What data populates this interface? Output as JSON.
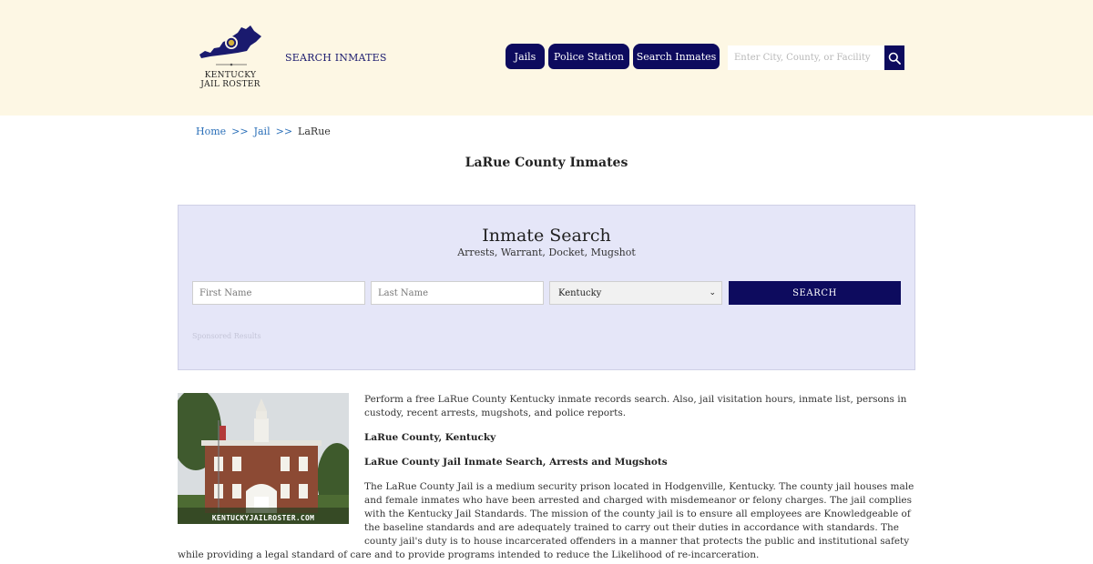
{
  "header": {
    "logo_line1": "KENTUCKY",
    "logo_line2": "JAIL ROSTER",
    "link_search": "SEARCH INMATES",
    "nav": [
      "Jails",
      "Police Station",
      "Search Inmates"
    ],
    "search_placeholder": "Enter City, County, or Facility",
    "search_icon": "magnifier-icon"
  },
  "breadcrumb": {
    "home": "Home",
    "sep1": ">>",
    "jail": "Jail",
    "sep2": ">>",
    "current": "LaRue"
  },
  "page_title": "LaRue County Inmates",
  "search_panel": {
    "title": "Inmate Search",
    "subtitle": "Arrests, Warrant, Docket, Mugshot",
    "first_placeholder": "First Name",
    "last_placeholder": "Last Name",
    "state_value": "Kentucky",
    "button": "SEARCH",
    "sponsored": "Sponsored Results"
  },
  "content": {
    "watermark": "KENTUCKYJAILROSTER.COM",
    "intro": "Perform a free LaRue County Kentucky inmate records search. Also, jail visitation hours, inmate list, persons in custody, recent arrests, mugshots, and police reports.",
    "heading1": "LaRue County, Kentucky",
    "heading2": "LaRue County Jail Inmate Search, Arrests and Mugshots",
    "body": "The LaRue County Jail is a medium security prison located in Hodgenville, Kentucky. The county jail houses male and female inmates who have been arrested and charged with misdemeanor or felony charges. The jail complies with the Kentucky Jail Standards. The mission of the county jail is to ensure all employees are Knowledgeable of the baseline standards and are adequately trained to carry out their duties in accordance with standards. The county jail's duty is to house incarcerated offenders in a manner that protects the public and institutional safety while providing a legal standard of care and to provide programs intended to reduce the Likelihood of re-incarceration."
  },
  "colors": {
    "header_bg": "#fdf7e4",
    "navy": "#0d0b5e",
    "link": "#2a6fb8",
    "panel_bg": "#e5e6f8"
  }
}
